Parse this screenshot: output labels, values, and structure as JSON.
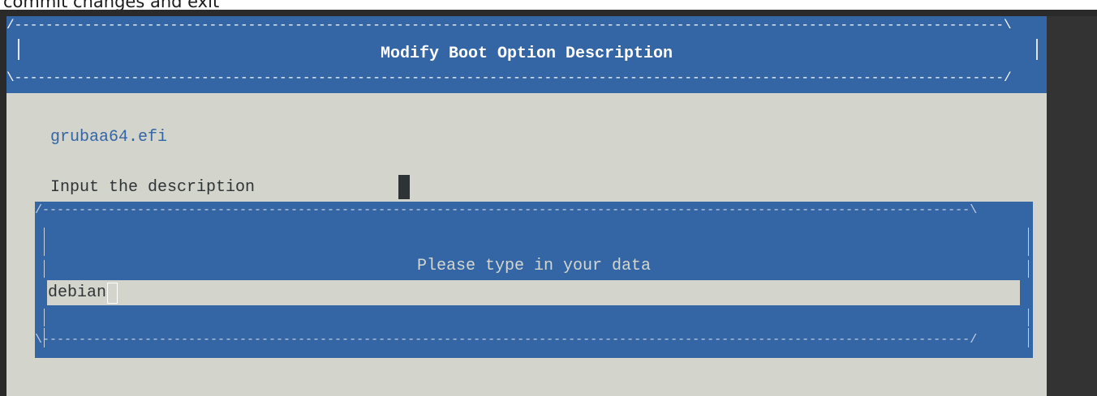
{
  "caption": {
    "text": "commit changes and exit"
  },
  "header": {
    "border_top": "/-------------------------------------------------------------------------------------------------------------------------------\\",
    "title": "Modify Boot Option Description",
    "border_bottom": "\\-------------------------------------------------------------------------------------------------------------------------------/"
  },
  "body": {
    "file_name": "grubaa64.efi",
    "prompt_label": "Input the description"
  },
  "dialog": {
    "border_top": "/-------------------------------------------------------------------------------------------------------------------------------\\",
    "title": "Please type in your data",
    "input_value": "debian",
    "border_bottom": "\\-------------------------------------------------------------------------------------------------------------------------------/"
  },
  "colors": {
    "screen_bg": "#d3d5cd",
    "accent_blue": "#3465a5",
    "terminal_frame": "#2a2a2a"
  }
}
